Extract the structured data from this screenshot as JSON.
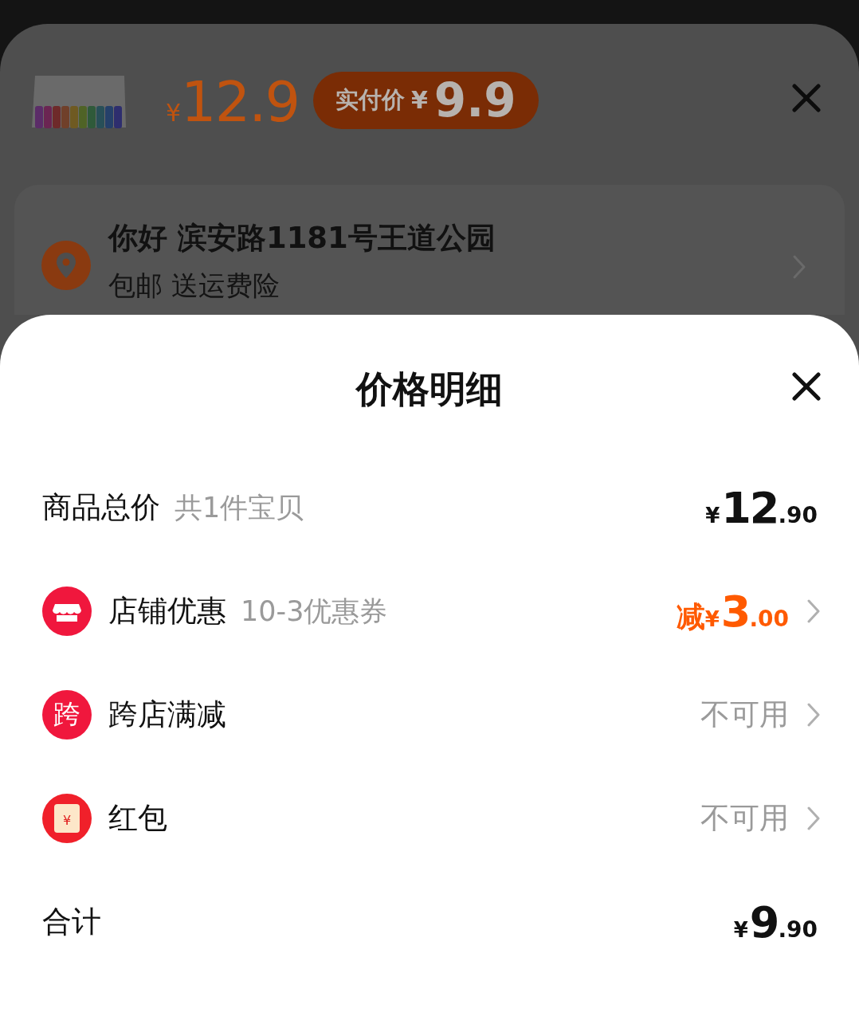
{
  "product": {
    "price": {
      "currency": "¥",
      "value": "12.9"
    },
    "paid_badge": {
      "label": "实付价",
      "currency": "¥",
      "value": "9.9"
    }
  },
  "address": {
    "title": "你好 滨安路1181号王道公园",
    "subtitle": "包邮 送运费险"
  },
  "price_detail": {
    "title": "价格明细",
    "rows": [
      {
        "kind": "subtotal",
        "label": "商品总价",
        "note": "共1件宝贝",
        "amount": {
          "currency": "¥",
          "integer": "12",
          "decimal": ".90"
        }
      },
      {
        "kind": "discount",
        "label": "店铺优惠",
        "note": "10-3优惠券",
        "amount": {
          "prefix": "减",
          "currency": "¥",
          "integer": "3",
          "decimal": ".00"
        }
      },
      {
        "kind": "unavailable",
        "icon_text": "跨",
        "label": "跨店满减",
        "status": "不可用"
      },
      {
        "kind": "unavailable",
        "icon_text": "¥",
        "label": "红包",
        "status": "不可用"
      },
      {
        "kind": "total",
        "label": "合计",
        "amount": {
          "currency": "¥",
          "integer": "9",
          "decimal": ".90"
        }
      }
    ]
  }
}
